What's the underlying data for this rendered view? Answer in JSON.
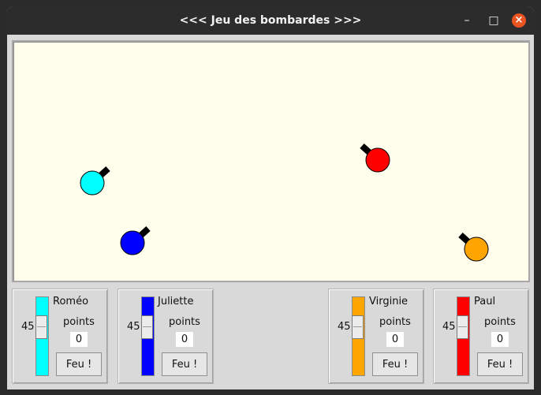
{
  "window": {
    "title": "<<< Jeu des bombardes >>>",
    "controls": {
      "minimize": "–",
      "maximize": "□",
      "close": "×"
    }
  },
  "canvas": {
    "background": "#fffeec"
  },
  "players": [
    {
      "name": "Roméo",
      "color": "#00ffff",
      "angle": "45",
      "points_label": "points",
      "score": "0",
      "fire_label": "Feu !"
    },
    {
      "name": "Juliette",
      "color": "#0000ff",
      "angle": "45",
      "points_label": "points",
      "score": "0",
      "fire_label": "Feu !"
    },
    {
      "name": "Virginie",
      "color": "#ffa500",
      "angle": "45",
      "points_label": "points",
      "score": "0",
      "fire_label": "Feu !"
    },
    {
      "name": "Paul",
      "color": "#ff0000",
      "angle": "45",
      "points_label": "points",
      "score": "0",
      "fire_label": "Feu !"
    }
  ]
}
